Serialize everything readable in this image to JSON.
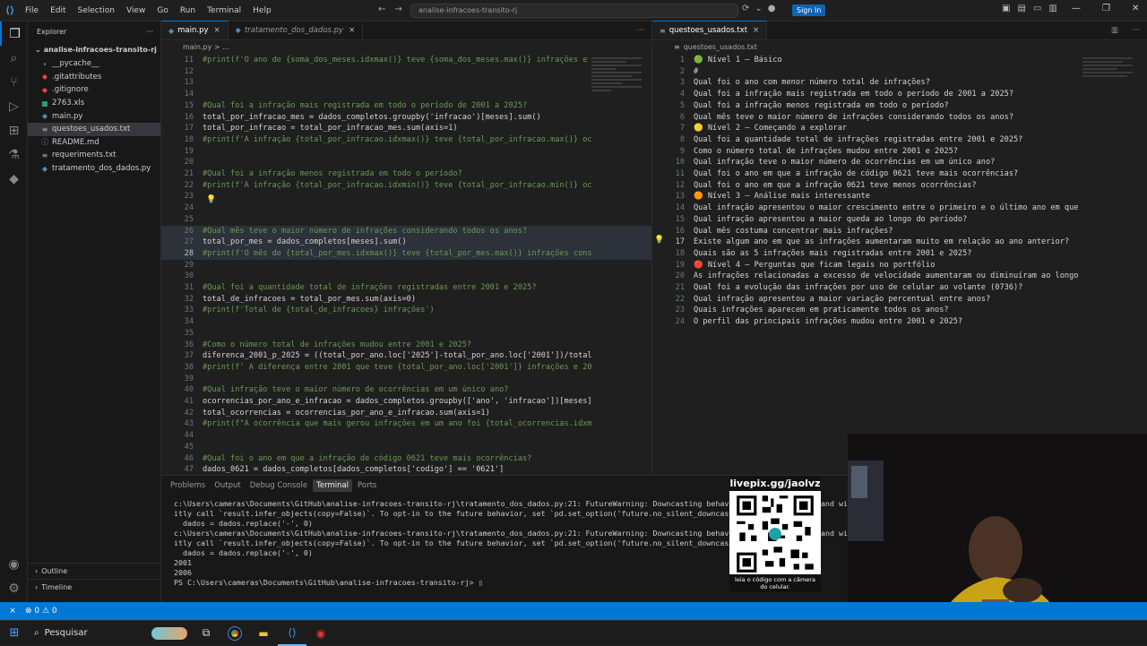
{
  "titlebar": {
    "menu": [
      "File",
      "Edit",
      "Selection",
      "View",
      "Go",
      "Run",
      "Terminal",
      "Help"
    ],
    "command_center": "analise-infracoes-transito-rj",
    "sign_in": "Sign In"
  },
  "sidebar": {
    "header": "Explorer",
    "root_folder": "analise-infracoes-transito-rj",
    "files": [
      {
        "name": "__pycache__",
        "icon": "chevron-right-icon"
      },
      {
        "name": ".gitattributes",
        "icon": "git-icon"
      },
      {
        "name": ".gitignore",
        "icon": "git-icon"
      },
      {
        "name": "2763.xls",
        "icon": "excel-icon"
      },
      {
        "name": "main.py",
        "icon": "python-icon"
      },
      {
        "name": "questoes_usados.txt",
        "icon": "text-file-icon"
      },
      {
        "name": "README.md",
        "icon": "info-icon"
      },
      {
        "name": "requeriments.txt",
        "icon": "text-file-icon"
      },
      {
        "name": "tratamento_dos_dados.py",
        "icon": "python-icon"
      }
    ],
    "outline": "Outline",
    "timeline": "Timeline"
  },
  "editor_left": {
    "tabs": [
      "main.py",
      "tratamento_dos_dados.py"
    ],
    "breadcrumb": "main.py > ...",
    "lines": [
      {
        "n": "11",
        "t": "#print(f'O ano de {soma_dos_meses.idxmax()} teve {soma_dos_meses.max()} infrações e",
        "c": "cm"
      },
      {
        "n": "12",
        "t": "",
        "c": ""
      },
      {
        "n": "13",
        "t": "",
        "c": ""
      },
      {
        "n": "14",
        "t": "",
        "c": ""
      },
      {
        "n": "15",
        "t": "#Qual foi a infração mais registrada em todo o período de 2001 a 2025?",
        "c": "cm"
      },
      {
        "n": "16",
        "t": "total_por_infracao_mes = dados_completos.groupby('infracao')[meses].sum()",
        "c": ""
      },
      {
        "n": "17",
        "t": "total_por_infracao = total_por_infracao_mes.sum(axis=1)",
        "c": ""
      },
      {
        "n": "18",
        "t": "#print(f'A infração {total_por_infracao.idxmax()} teve {total_por_infracao.max()} oc",
        "c": "cm"
      },
      {
        "n": "19",
        "t": "",
        "c": ""
      },
      {
        "n": "20",
        "t": "",
        "c": ""
      },
      {
        "n": "21",
        "t": "#Qual foi a infração menos registrada em todo o período?",
        "c": "cm"
      },
      {
        "n": "22",
        "t": "#print(f'A infração {total_por_infracao.idxmin()} teve {total_por_infracao.min()} oc",
        "c": "cm"
      },
      {
        "n": "23",
        "t": "",
        "c": ""
      },
      {
        "n": "24",
        "t": "",
        "c": ""
      },
      {
        "n": "25",
        "t": "",
        "c": ""
      },
      {
        "n": "26",
        "t": "#Qual mês teve o maior número de infrações considerando todos os anos?",
        "c": "cm hl"
      },
      {
        "n": "27",
        "t": "total_por_mes = dados_completos[meses].sum()",
        "c": "hl"
      },
      {
        "n": "28",
        "t": "#print(f'O mês de {total_por_mes.idxmax()} teve {total_por_mes.max()} infrações cons",
        "c": "cm hl"
      },
      {
        "n": "29",
        "t": "",
        "c": ""
      },
      {
        "n": "30",
        "t": "",
        "c": ""
      },
      {
        "n": "31",
        "t": "#Qual foi a quantidade total de infrações registradas entre 2001 e 2025?",
        "c": "cm"
      },
      {
        "n": "32",
        "t": "total_de_infracoes = total_por_mes.sum(axis=0)",
        "c": ""
      },
      {
        "n": "33",
        "t": "#print(f'Total de {total_de_infracoes} infrações')",
        "c": "cm"
      },
      {
        "n": "34",
        "t": "",
        "c": ""
      },
      {
        "n": "35",
        "t": "",
        "c": ""
      },
      {
        "n": "36",
        "t": "#Como o número total de infrações mudou entre 2001 e 2025?",
        "c": "cm"
      },
      {
        "n": "37",
        "t": "diferenca_2001_p_2025 = ((total_por_ano.loc['2025']-total_por_ano.loc['2001'])/total",
        "c": ""
      },
      {
        "n": "38",
        "t": "#print(f' A diferença entre 2001 que teve {total_por_ano.loc['2001']} infrações e 20",
        "c": "cm"
      },
      {
        "n": "39",
        "t": "",
        "c": ""
      },
      {
        "n": "40",
        "t": "#Qual infração teve o maior número de ocorrências em um único ano?",
        "c": "cm"
      },
      {
        "n": "41",
        "t": "ocorrencias_por_ano_e_infracao = dados_completos.groupby(['ano', 'infracao'])[meses]",
        "c": ""
      },
      {
        "n": "42",
        "t": "total_ocorrencias = ocorrencias_por_ano_e_infracao.sum(axis=1)",
        "c": ""
      },
      {
        "n": "43",
        "t": "#print(f\"A ocorrência que mais gerou infrações em um ano foi {total_ocorrencias.idxm",
        "c": "cm"
      },
      {
        "n": "44",
        "t": "",
        "c": ""
      },
      {
        "n": "45",
        "t": "",
        "c": ""
      },
      {
        "n": "46",
        "t": "#Qual foi o ano em que a infração de código 0621 teve mais ocorrências?",
        "c": "cm"
      },
      {
        "n": "47",
        "t": "dados_0621 = dados_completos[dados_completos['codigo'] == '0621']",
        "c": ""
      }
    ]
  },
  "editor_right": {
    "tab": "questoes_usados.txt",
    "breadcrumb": "questoes_usados.txt",
    "lines": [
      {
        "n": "1",
        "t": "🟢 Nível 1 — Básico"
      },
      {
        "n": "2",
        "t": "#"
      },
      {
        "n": "3",
        "t": "Qual foi o ano com menor número total de infrações?"
      },
      {
        "n": "4",
        "t": "Qual foi a infração mais registrada em todo o período de 2001 a 2025?"
      },
      {
        "n": "5",
        "t": "Qual foi a infração menos registrada em todo o período?"
      },
      {
        "n": "6",
        "t": "Qual mês teve o maior número de infrações considerando todos os anos?"
      },
      {
        "n": "7",
        "t": "🟡 Nível 2 — Começando a explorar"
      },
      {
        "n": "8",
        "t": "Qual foi a quantidade total de infrações registradas entre 2001 e 2025?"
      },
      {
        "n": "9",
        "t": "Como o número total de infrações mudou entre 2001 e 2025?"
      },
      {
        "n": "10",
        "t": "Qual infração teve o maior número de ocorrências em um único ano?"
      },
      {
        "n": "11",
        "t": "Qual foi o ano em que a infração de código 0621 teve mais ocorrências?"
      },
      {
        "n": "12",
        "t": "Qual foi o ano em que a infração 0621 teve menos ocorrências?"
      },
      {
        "n": "13",
        "t": "🟠 Nível 3 — Análise mais interessante"
      },
      {
        "n": "14",
        "t": "Qual infração apresentou o maior crescimento entre o primeiro e o último ano em que"
      },
      {
        "n": "15",
        "t": "Qual infração apresentou a maior queda ao longo do período?"
      },
      {
        "n": "16",
        "t": "Qual mês costuma concentrar mais infrações?"
      },
      {
        "n": "17",
        "t": "Existe algum ano em que as infrações aumentaram muito em relação ao ano anterior?"
      },
      {
        "n": "18",
        "t": "Quais são as 5 infrações mais registradas entre 2001 e 2025?"
      },
      {
        "n": "19",
        "t": "🔴 Nível 4 — Perguntas que ficam legais no portfólio"
      },
      {
        "n": "20",
        "t": "As infrações relacionadas a excesso de velocidade aumentaram ou diminuíram ao longo"
      },
      {
        "n": "21",
        "t": "Qual foi a evolução das infrações por uso de celular ao volante (0736)?"
      },
      {
        "n": "22",
        "t": "Qual infração apresentou a maior variação percentual entre anos?"
      },
      {
        "n": "23",
        "t": "Quais infrações aparecem em praticamente todos os anos?"
      },
      {
        "n": "24",
        "t": "O perfil das principais infrações mudou entre 2001 e 2025?"
      }
    ]
  },
  "panel": {
    "tabs": [
      "Problems",
      "Output",
      "Debug Console",
      "Terminal",
      "Ports"
    ],
    "active_tab": "Terminal",
    "terminal": "c:\\Users\\cameras\\Documents\\GitHub\\analise-infracoes-transito-rj\\tratamento_dos_dados.py:21: FutureWarning: Downcasting behavior in `r\nitly call `result.infer_objects(copy=False)`. To opt-in to the future behavior, set `pd.set_option('future.no_silent_downcasting', Tr\n  dados = dados.replace('-', 0)\nc:\\Users\\cameras\\Documents\\GitHub\\analise-infracoes-transito-rj\\tratamento_dos_dados.py:21: FutureWarning: Downcasting behavior in `r\nitly call `result.infer_objects(copy=False)`. To opt-in to the future behavior, set `pd.set_option('future.no_silent_downcasting', Tr\n  dados = dados.replace('-', 0)\n2001\n2006\nPS C:\\Users\\cameras\\Documents\\GitHub\\analise-infracoes-transito-rj> ▯",
    "terminal_right": "and wi\n\n\nand wi"
  },
  "overlay": {
    "qr_title": "livepix.gg/jaolvz",
    "qr_caption": "leia o código com a câmera do celular."
  },
  "statusbar": {
    "problems": "⊗ 0 ⚠ 0"
  },
  "taskbar": {
    "search": "Pesquisar"
  }
}
